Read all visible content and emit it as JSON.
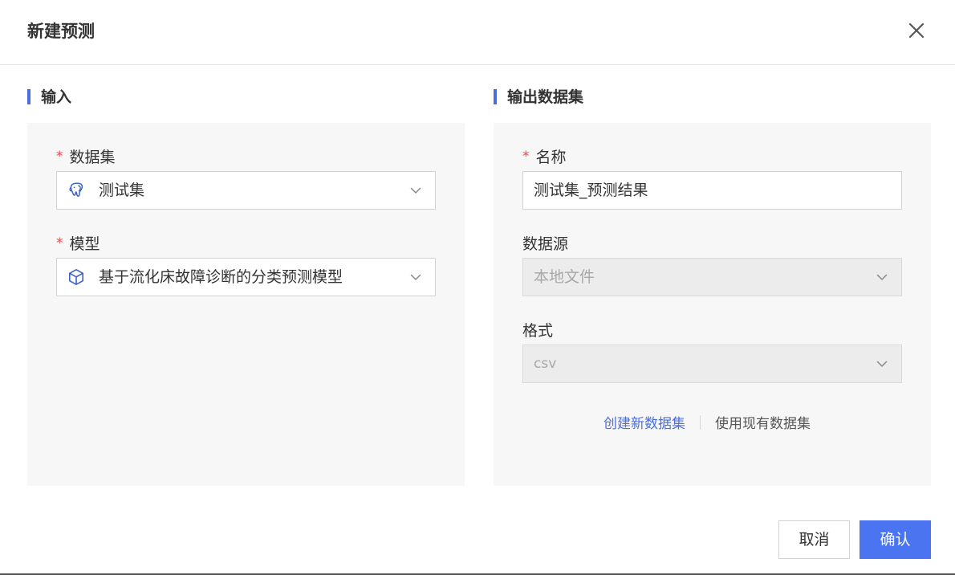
{
  "dialog": {
    "title": "新建预测"
  },
  "input_section": {
    "title": "输入",
    "dataset": {
      "label": "数据集",
      "required_mark": "*",
      "value": "测试集",
      "icon": "postgresql-elephant-icon"
    },
    "model": {
      "label": "模型",
      "required_mark": "*",
      "value": "基于流化床故障诊断的分类预测模型",
      "icon": "cube-icon"
    }
  },
  "output_section": {
    "title": "输出数据集",
    "name": {
      "label": "名称",
      "required_mark": "*",
      "value": "测试集_预测结果"
    },
    "datasource": {
      "label": "数据源",
      "value": "本地文件",
      "disabled": true
    },
    "format": {
      "label": "格式",
      "value": "csv",
      "disabled": true
    },
    "links": {
      "create": "创建新数据集",
      "existing": "使用现有数据集"
    }
  },
  "footer": {
    "cancel_label": "取消",
    "confirm_label": "确认"
  },
  "colors": {
    "accent": "#4a74f0",
    "required": "#e5484d",
    "panel_bg": "#f7f7f7"
  }
}
